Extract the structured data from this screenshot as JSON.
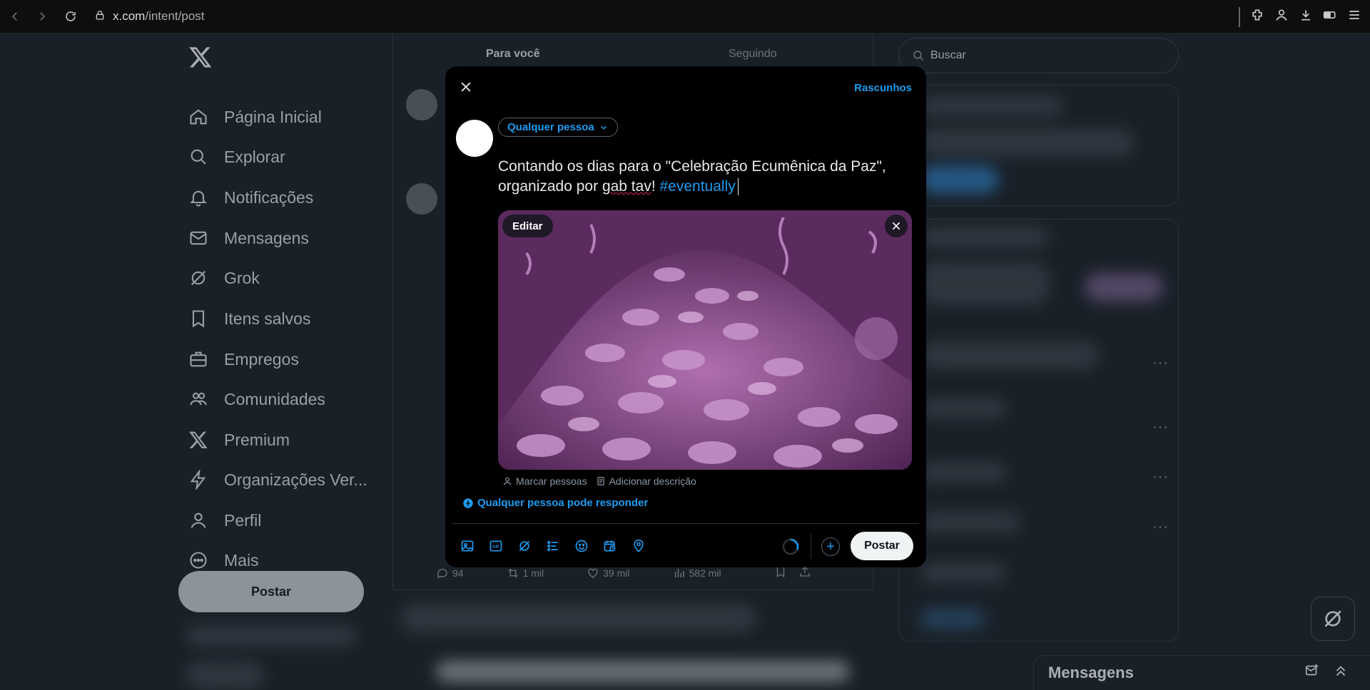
{
  "browser": {
    "url_host": "x.com",
    "url_path": "/intent/post"
  },
  "nav": {
    "items": [
      {
        "label": "Página Inicial",
        "icon": "home-icon"
      },
      {
        "label": "Explorar",
        "icon": "search-icon"
      },
      {
        "label": "Notificações",
        "icon": "bell-icon"
      },
      {
        "label": "Mensagens",
        "icon": "mail-icon"
      },
      {
        "label": "Grok",
        "icon": "grok-icon"
      },
      {
        "label": "Itens salvos",
        "icon": "bookmark-icon"
      },
      {
        "label": "Empregos",
        "icon": "briefcase-icon"
      },
      {
        "label": "Comunidades",
        "icon": "people-icon"
      },
      {
        "label": "Premium",
        "icon": "x-logo-icon"
      },
      {
        "label": "Organizações Ver...",
        "icon": "lightning-icon"
      },
      {
        "label": "Perfil",
        "icon": "person-icon"
      },
      {
        "label": "Mais",
        "icon": "more-circle-icon"
      }
    ],
    "post_label": "Postar"
  },
  "feed": {
    "tabs": [
      "Para você",
      "Seguindo"
    ],
    "stats": {
      "replies": "94",
      "reposts": "1 mil",
      "likes": "39 mil",
      "views": "582 mil"
    }
  },
  "search": {
    "placeholder": "Buscar"
  },
  "messages_bar": {
    "title": "Mensagens"
  },
  "compose": {
    "drafts_label": "Rascunhos",
    "audience_label": "Qualquer pessoa",
    "text_line1": "Contando os dias para o \"Celebração Ecumênica da Paz\",",
    "text_line2_before": "organizado por ",
    "text_line2_misspelled": "gab tav",
    "text_line2_after": "! ",
    "hashtag": "#eventually",
    "media": {
      "edit_label": "Editar"
    },
    "tag_people_label": "Marcar pessoas",
    "add_description_label": "Adicionar descrição",
    "reply_setting_label": "Qualquer pessoa pode responder",
    "toolbar_icons": [
      "image-icon",
      "gif-icon",
      "grok-icon",
      "poll-icon",
      "emoji-icon",
      "schedule-icon",
      "location-icon"
    ],
    "submit_label": "Postar",
    "accent_color": "#1d9bf0"
  }
}
